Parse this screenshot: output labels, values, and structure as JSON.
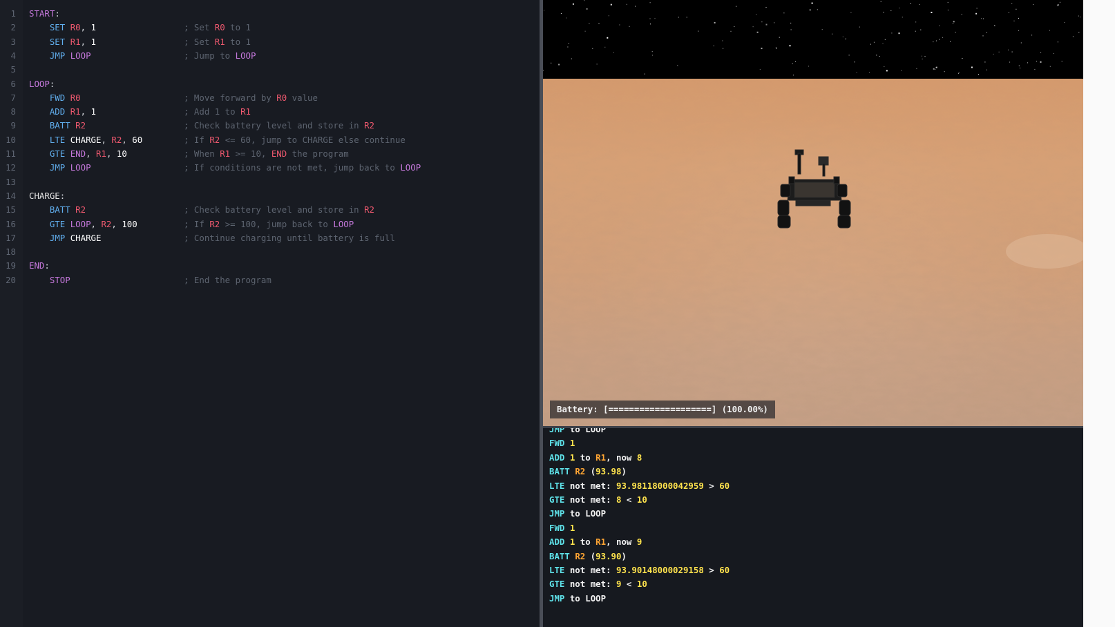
{
  "editor": {
    "lines": [
      {
        "n": "1",
        "tokens": [
          [
            "lbl",
            "START"
          ],
          [
            "pl",
            ":"
          ]
        ]
      },
      {
        "n": "2",
        "tokens": [
          [
            "op",
            "SET"
          ],
          [
            "sp",
            " "
          ],
          [
            "reg",
            "R0"
          ],
          [
            "pl",
            ", "
          ],
          [
            "num",
            "1"
          ]
        ],
        "comment": [
          [
            "c",
            "; Set "
          ],
          [
            "cr",
            "R0"
          ],
          [
            "c",
            " to 1"
          ]
        ]
      },
      {
        "n": "3",
        "tokens": [
          [
            "op",
            "SET"
          ],
          [
            "sp",
            " "
          ],
          [
            "reg",
            "R1"
          ],
          [
            "pl",
            ", "
          ],
          [
            "num",
            "1"
          ]
        ],
        "comment": [
          [
            "c",
            "; Set "
          ],
          [
            "cr",
            "R1"
          ],
          [
            "c",
            " to 1"
          ]
        ]
      },
      {
        "n": "4",
        "tokens": [
          [
            "op",
            "JMP"
          ],
          [
            "sp",
            " "
          ],
          [
            "opp",
            "LOOP"
          ]
        ],
        "comment": [
          [
            "c",
            "; Jump to "
          ],
          [
            "cp",
            "LOOP"
          ]
        ]
      },
      {
        "n": "5",
        "tokens": []
      },
      {
        "n": "6",
        "tokens": [
          [
            "lbl",
            "LOOP"
          ],
          [
            "pl",
            ":"
          ]
        ]
      },
      {
        "n": "7",
        "tokens": [
          [
            "op",
            "FWD"
          ],
          [
            "sp",
            " "
          ],
          [
            "reg",
            "R0"
          ]
        ],
        "comment": [
          [
            "c",
            "; Move forward by "
          ],
          [
            "cr",
            "R0"
          ],
          [
            "c",
            " value"
          ]
        ]
      },
      {
        "n": "8",
        "tokens": [
          [
            "op",
            "ADD"
          ],
          [
            "sp",
            " "
          ],
          [
            "reg",
            "R1"
          ],
          [
            "pl",
            ", "
          ],
          [
            "num",
            "1"
          ]
        ],
        "comment": [
          [
            "c",
            "; Add 1 to "
          ],
          [
            "cr",
            "R1"
          ]
        ]
      },
      {
        "n": "9",
        "tokens": [
          [
            "op",
            "BATT"
          ],
          [
            "sp",
            " "
          ],
          [
            "reg",
            "R2"
          ]
        ],
        "comment": [
          [
            "c",
            "; Check battery level and store in "
          ],
          [
            "cr",
            "R2"
          ]
        ]
      },
      {
        "n": "10",
        "tokens": [
          [
            "op",
            "LTE"
          ],
          [
            "sp",
            " "
          ],
          [
            "num",
            "CHARGE"
          ],
          [
            "pl",
            ", "
          ],
          [
            "reg",
            "R2"
          ],
          [
            "pl",
            ", "
          ],
          [
            "num",
            "60"
          ]
        ],
        "comment": [
          [
            "c",
            "; If "
          ],
          [
            "cr",
            "R2"
          ],
          [
            "c",
            " <= 60, jump to CHARGE else continue"
          ]
        ]
      },
      {
        "n": "11",
        "tokens": [
          [
            "op",
            "GTE"
          ],
          [
            "sp",
            " "
          ],
          [
            "opp",
            "END"
          ],
          [
            "pl",
            ", "
          ],
          [
            "reg",
            "R1"
          ],
          [
            "pl",
            ", "
          ],
          [
            "num",
            "10"
          ]
        ],
        "comment": [
          [
            "c",
            "; When "
          ],
          [
            "cr",
            "R1"
          ],
          [
            "c",
            " >= 10, "
          ],
          [
            "cr",
            "END"
          ],
          [
            "c",
            " the program"
          ]
        ]
      },
      {
        "n": "12",
        "tokens": [
          [
            "op",
            "JMP"
          ],
          [
            "sp",
            " "
          ],
          [
            "opp",
            "LOOP"
          ]
        ],
        "comment": [
          [
            "c",
            "; If conditions are not met, jump back to "
          ],
          [
            "cp",
            "LOOP"
          ]
        ]
      },
      {
        "n": "13",
        "tokens": []
      },
      {
        "n": "14",
        "tokens": [
          [
            "lblw",
            "CHARGE"
          ],
          [
            "pl",
            ":"
          ]
        ]
      },
      {
        "n": "15",
        "tokens": [
          [
            "op",
            "BATT"
          ],
          [
            "sp",
            " "
          ],
          [
            "reg",
            "R2"
          ]
        ],
        "comment": [
          [
            "c",
            "; Check battery level and store in "
          ],
          [
            "cr",
            "R2"
          ]
        ]
      },
      {
        "n": "16",
        "tokens": [
          [
            "op",
            "GTE"
          ],
          [
            "sp",
            " "
          ],
          [
            "opp",
            "LOOP"
          ],
          [
            "pl",
            ", "
          ],
          [
            "reg",
            "R2"
          ],
          [
            "pl",
            ", "
          ],
          [
            "num",
            "100"
          ]
        ],
        "comment": [
          [
            "c",
            "; If "
          ],
          [
            "cr",
            "R2"
          ],
          [
            "c",
            " >= 100, jump back to "
          ],
          [
            "cp",
            "LOOP"
          ]
        ]
      },
      {
        "n": "17",
        "tokens": [
          [
            "op",
            "JMP"
          ],
          [
            "sp",
            " "
          ],
          [
            "num",
            "CHARGE"
          ]
        ],
        "comment": [
          [
            "c",
            "; Continue charging until battery is full"
          ]
        ]
      },
      {
        "n": "18",
        "tokens": []
      },
      {
        "n": "19",
        "tokens": [
          [
            "lbl",
            "END"
          ],
          [
            "pl",
            ":"
          ]
        ]
      },
      {
        "n": "20",
        "tokens": [
          [
            "opp",
            "STOP"
          ]
        ],
        "comment": [
          [
            "c",
            "; End the program"
          ]
        ]
      }
    ]
  },
  "viewport": {
    "battery_text": "Battery: [====================] (100.00%)",
    "colors": {
      "sky": "#000000",
      "ground": "#d59a6d"
    }
  },
  "console": {
    "lines": [
      [
        [
          "cmd",
          "JMP"
        ],
        [
          "txt",
          " to LOOP"
        ]
      ],
      [
        [
          "cmd",
          "FWD"
        ],
        [
          "txt",
          " "
        ],
        [
          "num",
          "1"
        ]
      ],
      [
        [
          "cmd",
          "ADD"
        ],
        [
          "txt",
          " "
        ],
        [
          "num",
          "1"
        ],
        [
          "txt",
          " to "
        ],
        [
          "reg",
          "R1"
        ],
        [
          "txt",
          ", now "
        ],
        [
          "num",
          "8"
        ]
      ],
      [
        [
          "cmd",
          "BATT"
        ],
        [
          "txt",
          " "
        ],
        [
          "reg",
          "R2"
        ],
        [
          "txt",
          " ("
        ],
        [
          "num",
          "93.98"
        ],
        [
          "txt",
          ")"
        ]
      ],
      [
        [
          "cmd",
          "LTE"
        ],
        [
          "txt",
          " not met: "
        ],
        [
          "num",
          "93.98118000042959"
        ],
        [
          "txt",
          " > "
        ],
        [
          "num",
          "60"
        ]
      ],
      [
        [
          "cmd",
          "GTE"
        ],
        [
          "txt",
          " not met: "
        ],
        [
          "num",
          "8"
        ],
        [
          "txt",
          " < "
        ],
        [
          "num",
          "10"
        ]
      ],
      [
        [
          "cmd",
          "JMP"
        ],
        [
          "txt",
          " to LOOP"
        ]
      ],
      [
        [
          "cmd",
          "FWD"
        ],
        [
          "txt",
          " "
        ],
        [
          "num",
          "1"
        ]
      ],
      [
        [
          "cmd",
          "ADD"
        ],
        [
          "txt",
          " "
        ],
        [
          "num",
          "1"
        ],
        [
          "txt",
          " to "
        ],
        [
          "reg",
          "R1"
        ],
        [
          "txt",
          ", now "
        ],
        [
          "num",
          "9"
        ]
      ],
      [
        [
          "cmd",
          "BATT"
        ],
        [
          "txt",
          " "
        ],
        [
          "reg",
          "R2"
        ],
        [
          "txt",
          " ("
        ],
        [
          "num",
          "93.90"
        ],
        [
          "txt",
          ")"
        ]
      ],
      [
        [
          "cmd",
          "LTE"
        ],
        [
          "txt",
          " not met: "
        ],
        [
          "num",
          "93.90148000029158"
        ],
        [
          "txt",
          " > "
        ],
        [
          "num",
          "60"
        ]
      ],
      [
        [
          "cmd",
          "GTE"
        ],
        [
          "txt",
          " not met: "
        ],
        [
          "num",
          "9"
        ],
        [
          "txt",
          " < "
        ],
        [
          "num",
          "10"
        ]
      ],
      [
        [
          "cmd",
          "JMP"
        ],
        [
          "txt",
          " to LOOP"
        ]
      ]
    ]
  }
}
